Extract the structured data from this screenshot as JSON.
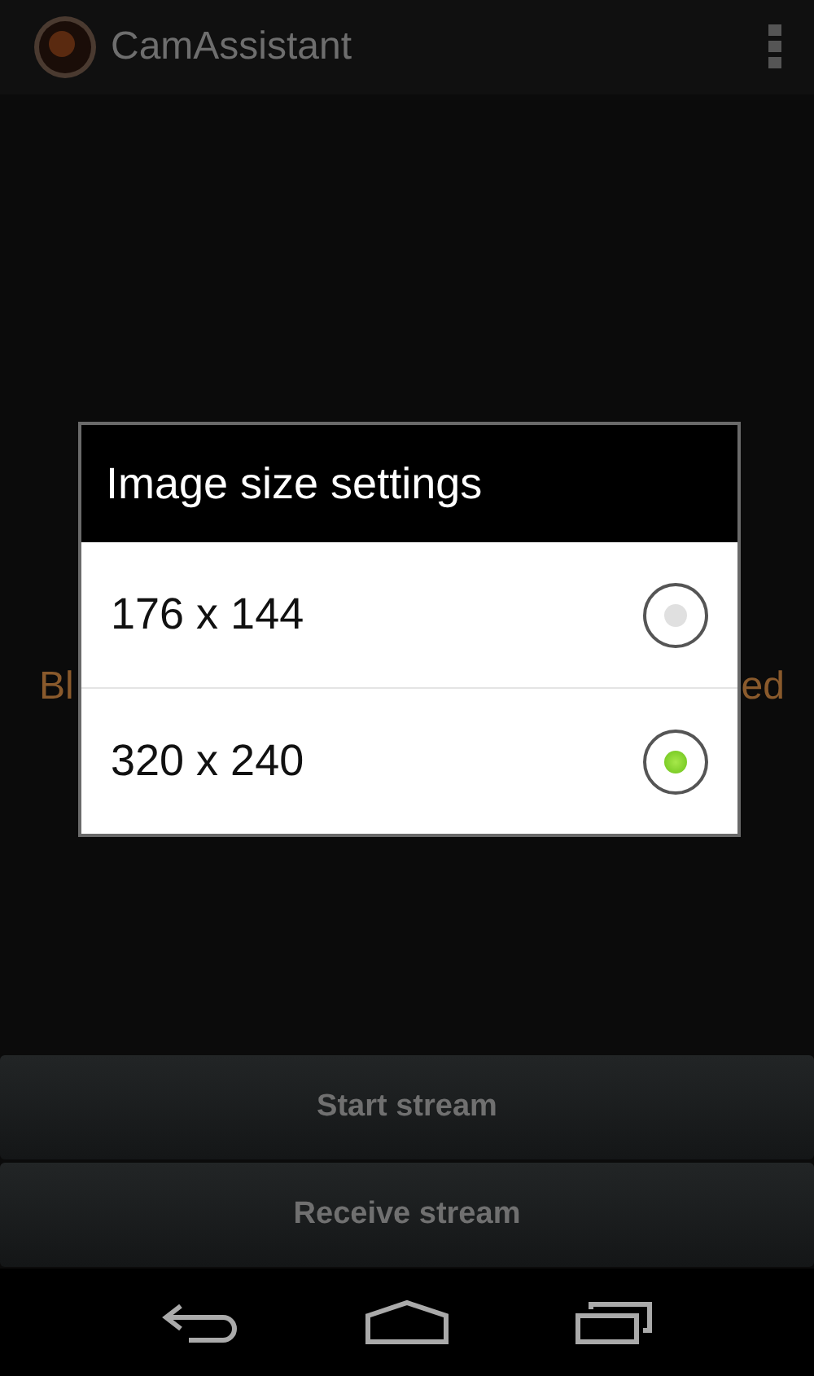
{
  "action_bar": {
    "title": "CamAssistant"
  },
  "background_message": {
    "left": "Bl",
    "right": "ed"
  },
  "dialog": {
    "title": "Image size settings",
    "options": [
      {
        "label": "176 x 144",
        "selected": false
      },
      {
        "label": "320 x 240",
        "selected": true
      }
    ]
  },
  "buttons": [
    "Start stream",
    "Receive stream"
  ]
}
